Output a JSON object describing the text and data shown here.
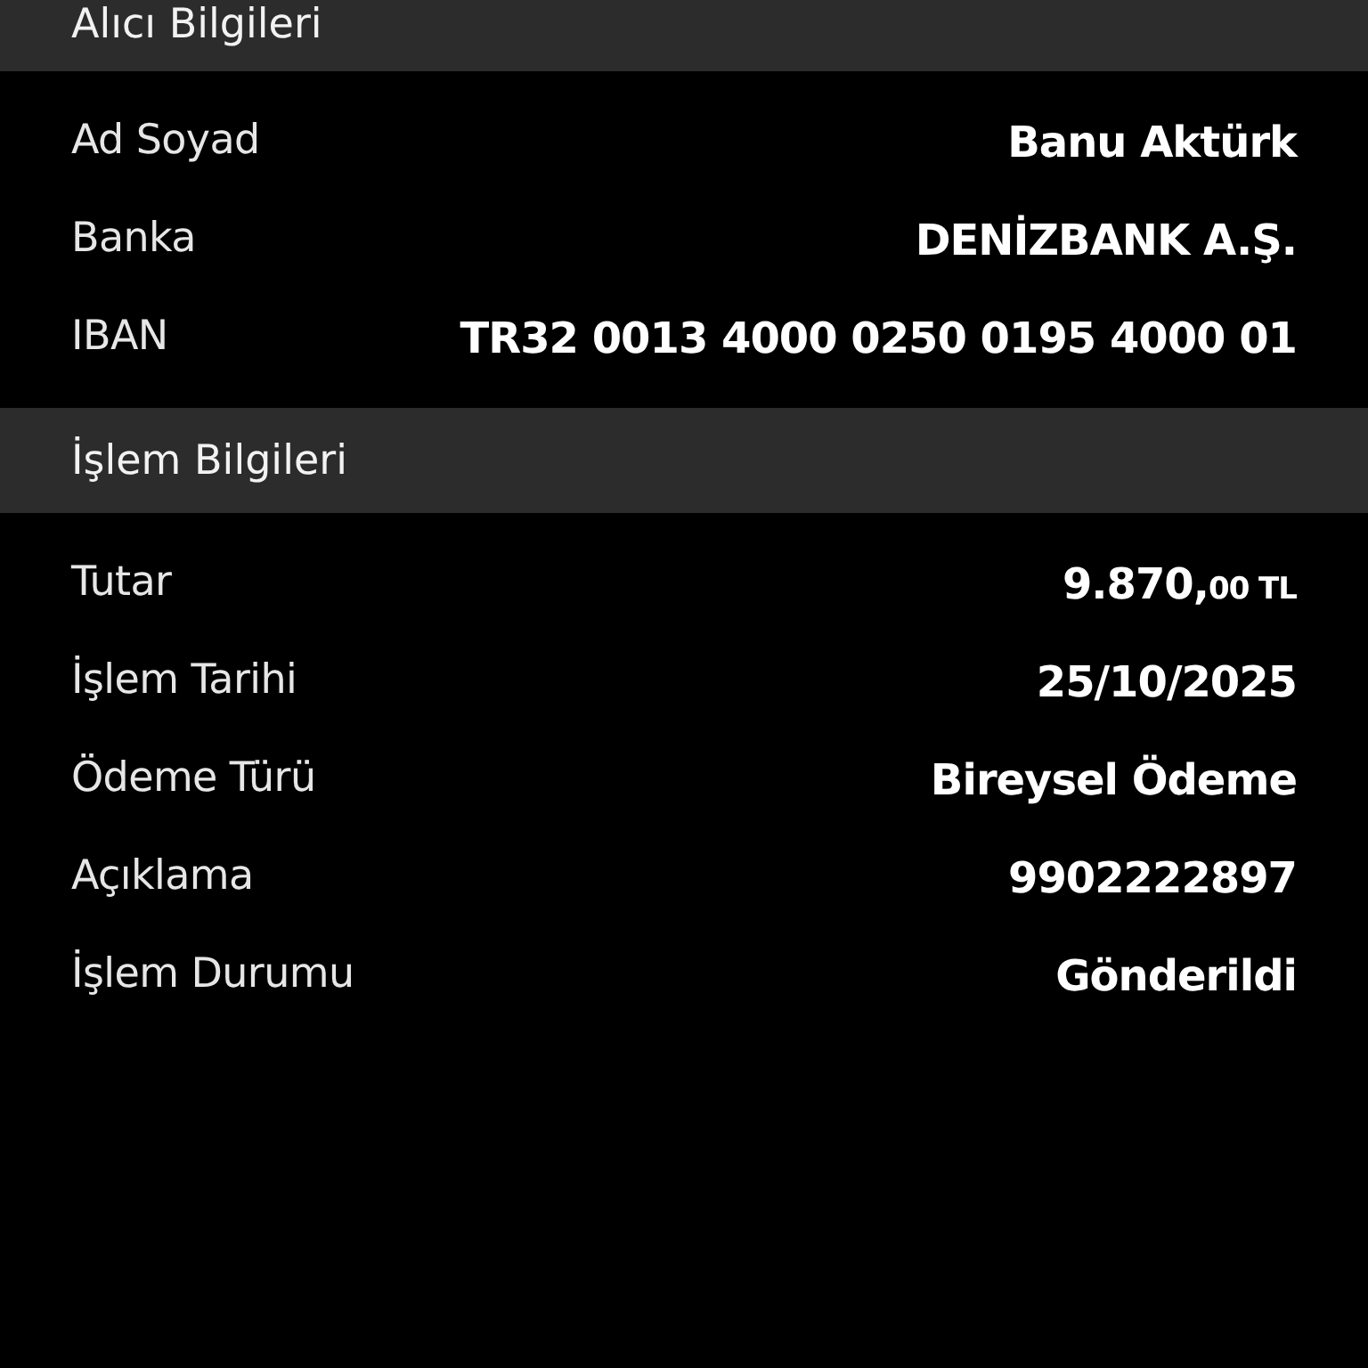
{
  "sections": [
    {
      "title": "Alıcı Bilgileri",
      "rows": [
        {
          "label": "Ad Soyad",
          "value": "Banu Aktürk"
        },
        {
          "label": "Banka",
          "value": "DENİZBANK A.Ş."
        },
        {
          "label": "IBAN",
          "value": "TR32 0013 4000 0250 0195 4000 01"
        }
      ]
    },
    {
      "title": "İşlem Bilgileri",
      "rows": [
        {
          "label": "Tutar",
          "value": "9.870,",
          "value_small": "00 TL"
        },
        {
          "label": "İşlem Tarihi",
          "value": "25/10/2025"
        },
        {
          "label": "Ödeme Türü",
          "value": "Bireysel Ödeme"
        },
        {
          "label": "Açıklama",
          "value": "9902222897"
        },
        {
          "label": "İşlem Durumu",
          "value": "Gönderildi"
        }
      ]
    }
  ]
}
